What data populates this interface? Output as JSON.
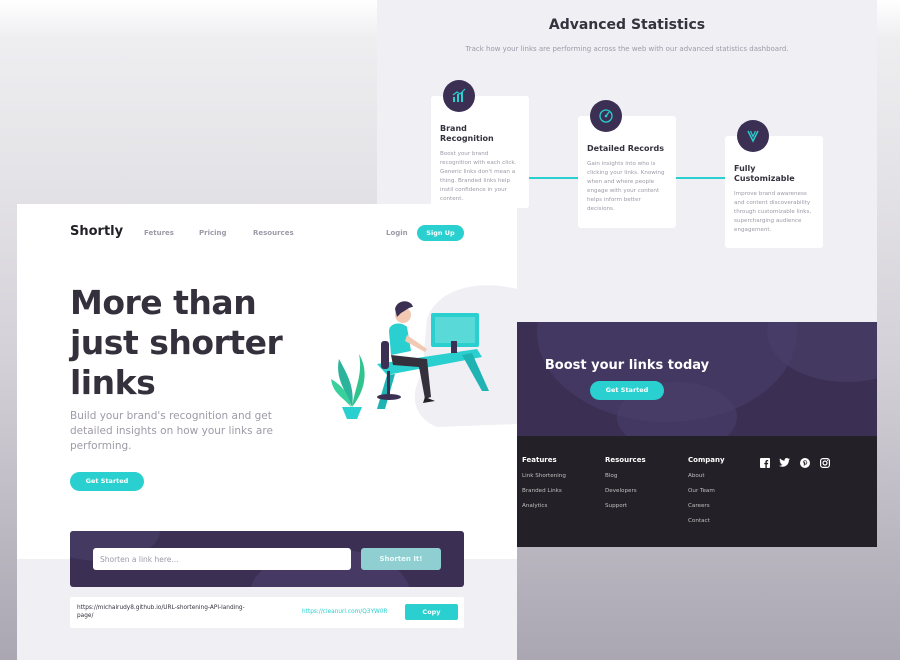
{
  "stats": {
    "title": "Advanced Statistics",
    "subtitle": "Track how your links are performing across the web with our advanced statistics dashboard.",
    "cards": [
      {
        "title": "Brand Recognition",
        "text": "Boost your brand recognition with each click. Generic links don't mean a thing. Branded links help instil confidence in your content.",
        "icon": "chart-icon"
      },
      {
        "title": "Detailed Records",
        "text": "Gain insights into who is clicking your links. Knowing when and where people engage with your content helps inform better decisions.",
        "icon": "gauge-icon"
      },
      {
        "title": "Fully Customizable",
        "text": "Improve brand awareness and content discoverability through customizable links, supercharging audience engagement.",
        "icon": "tools-icon"
      }
    ]
  },
  "boost": {
    "title": "Boost your links today",
    "button": "Get Started"
  },
  "footer": {
    "columns": [
      {
        "title": "Features",
        "links": [
          "Link Shortening",
          "Branded Links",
          "Analytics"
        ]
      },
      {
        "title": "Resources",
        "links": [
          "Blog",
          "Developers",
          "Support"
        ]
      },
      {
        "title": "Company",
        "links": [
          "About",
          "Our Team",
          "Careers",
          "Contact"
        ]
      }
    ],
    "social": [
      "facebook-icon",
      "twitter-icon",
      "pinterest-icon",
      "instagram-icon"
    ]
  },
  "header": {
    "logo": "Shortly",
    "nav": [
      "Fetures",
      "Pricing",
      "Resources"
    ],
    "login": "Login",
    "signup": "Sign Up"
  },
  "hero": {
    "title": "More than just shorter links",
    "subtitle": "Build your brand's recognition and get detailed insights on how your links are performing.",
    "button": "Get Started"
  },
  "shortener": {
    "placeholder": "Shorten a link here...",
    "button": "Shorten It!"
  },
  "result": {
    "original": "https://michalrudy8.github.io/URL-shortening-API-landing-page/",
    "short": "https://cleanuri.com/Q3YW0R",
    "copy": "Copy"
  },
  "colors": {
    "cyan": "#2acfcf",
    "dark_violet": "#3b3054",
    "very_dark": "#232127",
    "gray": "#9e9aa7"
  }
}
